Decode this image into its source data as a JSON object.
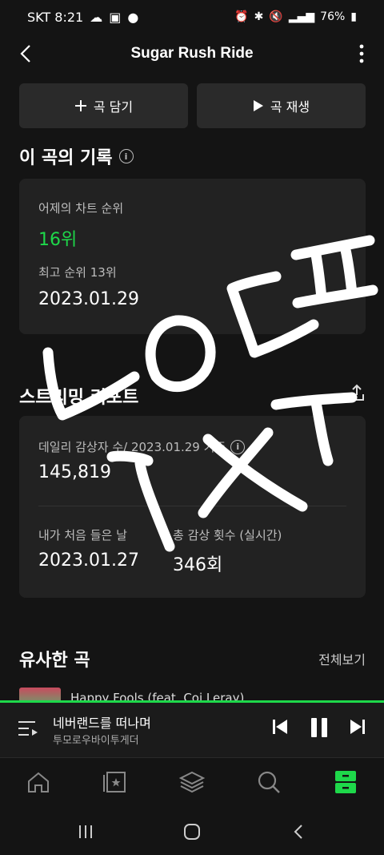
{
  "status_bar": {
    "carrier_time": "SKT 8:21",
    "battery": "76%"
  },
  "header": {
    "title": "Sugar Rush Ride"
  },
  "actions": {
    "add_label": "곡 담기",
    "play_label": "곡 재생"
  },
  "record": {
    "section_title": "이 곡의 기록",
    "yesterday_label": "어제의 차트 순위",
    "yesterday_rank": "16위",
    "best_label": "최고 순위 13위",
    "best_date": "2023.01.29"
  },
  "streaming": {
    "section_title": "스트리밍 리포트",
    "daily_label": "데일리 감상자 수/ 2023.01.29 기준",
    "daily_value": "145,819",
    "first_label": "내가 처음 들은 날",
    "first_value": "2023.01.27",
    "count_label": "총 감상 횟수 (실시간)",
    "count_value": "346회"
  },
  "similar": {
    "section_title": "유사한 곡",
    "see_all": "전체보기",
    "first_song": "Happy Fools (feat. Coi Leray)"
  },
  "player": {
    "title": "네버랜드를 떠나며",
    "artist": "투모로우바이투게더"
  },
  "colors": {
    "accent": "#1ed84a",
    "background": "#141414",
    "card": "#222222"
  },
  "handwriting": {
    "line1": "ㄴㅇㄷㅍ",
    "line2": "TXT"
  }
}
